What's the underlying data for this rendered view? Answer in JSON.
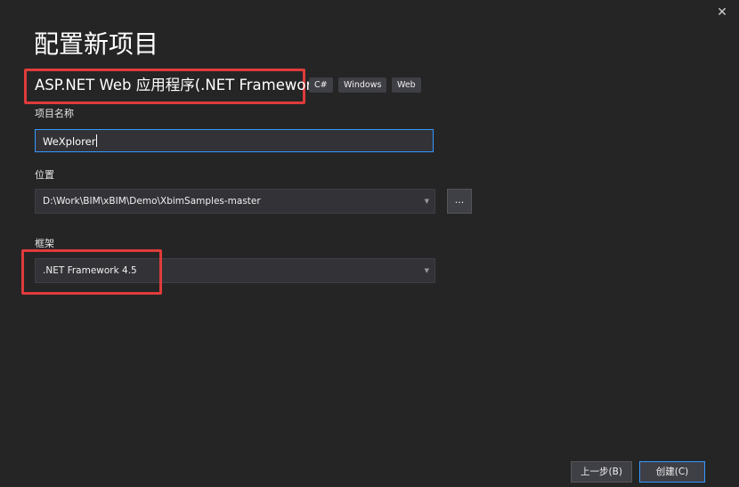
{
  "window": {
    "close_glyph": "✕"
  },
  "page_title": "配置新项目",
  "project_type": {
    "name": "ASP.NET Web 应用程序(.NET Framework)",
    "tags": [
      "C#",
      "Windows",
      "Web"
    ]
  },
  "project_name": {
    "label": "项目名称",
    "value": "WeXplorer"
  },
  "location": {
    "label": "位置",
    "value": "D:\\Work\\BIM\\xBIM\\Demo\\XbimSamples-master",
    "browse_label": "..."
  },
  "framework": {
    "label": "框架",
    "value": ".NET Framework 4.5"
  },
  "footer": {
    "back_label": "上一步(B)",
    "create_label": "创建(C)"
  },
  "dropdown_glyph": "▼",
  "colors": {
    "background": "#252526",
    "highlight_box": "#e03b3b",
    "focus_border": "#3399ff",
    "input_background": "#333337"
  }
}
